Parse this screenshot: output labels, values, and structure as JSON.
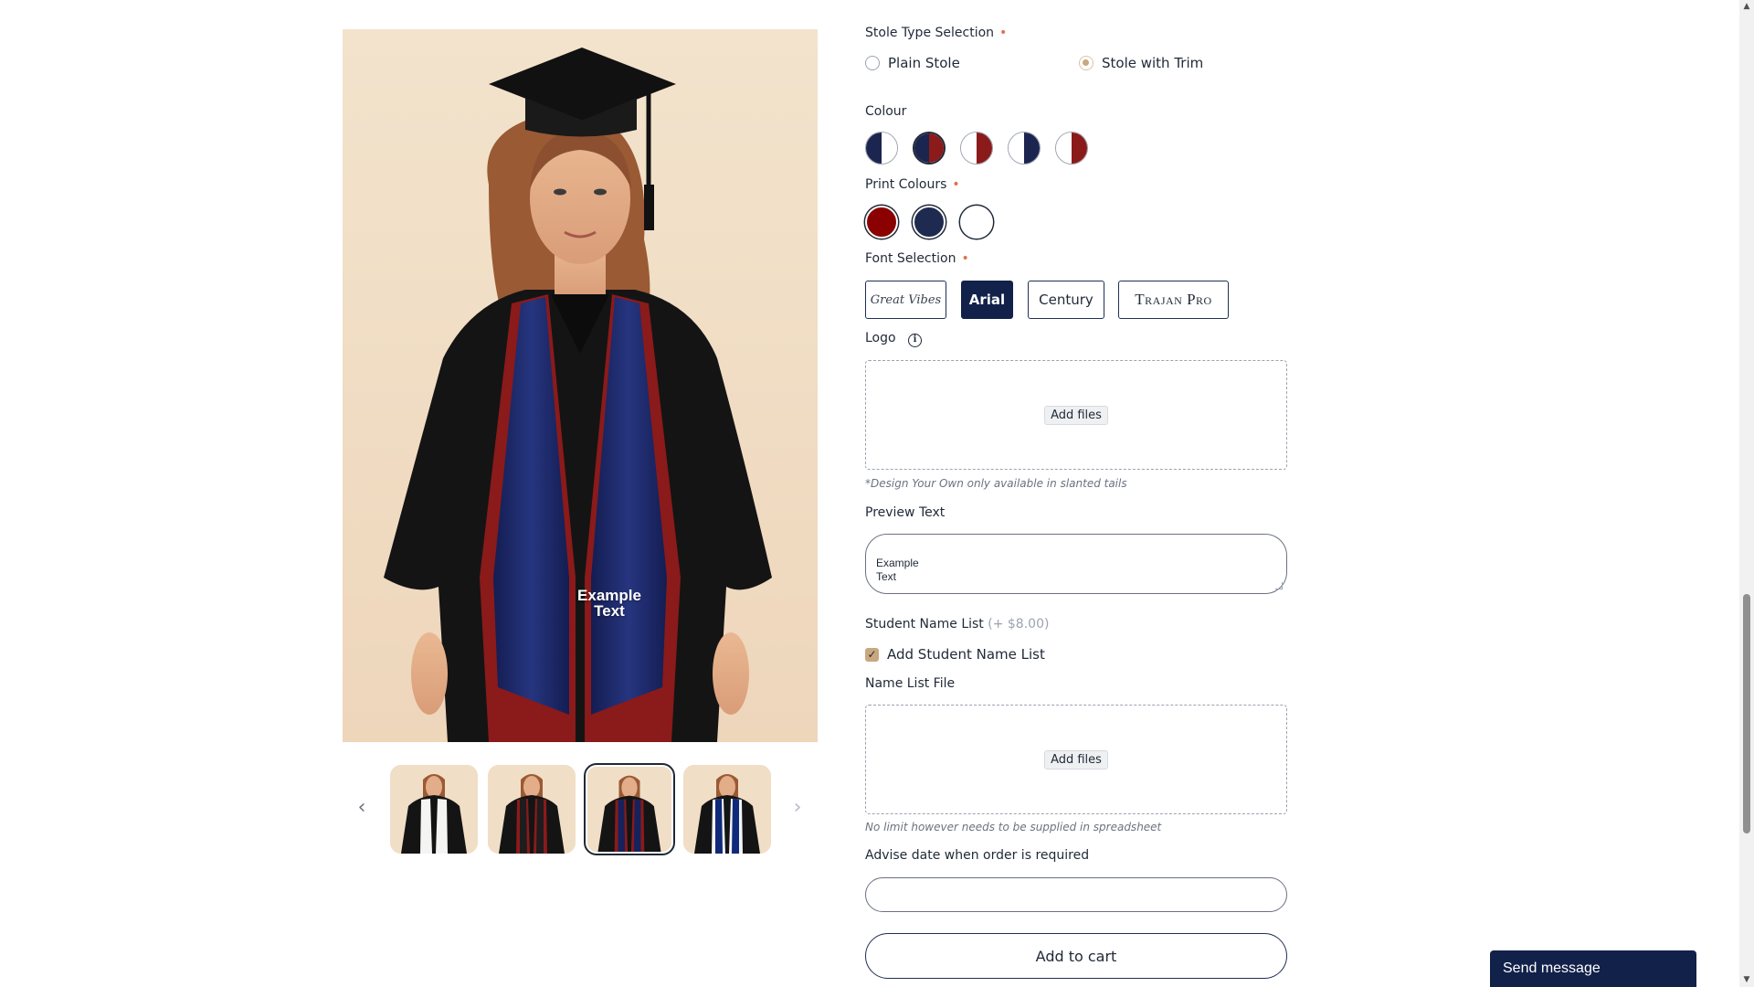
{
  "gallery": {
    "preview_text": "Example\nText",
    "prev_icon": "chevron-left-icon",
    "next_icon": "chevron-right-icon",
    "thumbnails": [
      {
        "stole": "#f4f4f2",
        "trim": "#ffffff"
      },
      {
        "stole": "#1d1d1f",
        "trim": "#8b1a1a"
      },
      {
        "stole": "#16225c",
        "trim": "#8b1a1a"
      },
      {
        "stole": "#102a7a",
        "trim": "#f4f4f4"
      }
    ],
    "active_thumbnail": 3
  },
  "stole_type": {
    "label": "Stole Type Selection",
    "required_mark": "•",
    "options": [
      "Plain Stole",
      "Stole with Trim"
    ],
    "selected": "Stole with Trim"
  },
  "colour": {
    "label": "Colour",
    "swatches": [
      {
        "left": "#1b2550",
        "right": "#ffffff"
      },
      {
        "left": "#1b2550",
        "right": "#8b1a1a"
      },
      {
        "left": "#ffffff",
        "right": "#8b1a1a"
      },
      {
        "left": "#ffffff",
        "right": "#1b2550"
      },
      {
        "left": "#ffffff",
        "right": "#8b1a1a"
      }
    ],
    "selected_index": 2
  },
  "print_colours": {
    "label": "Print Colours",
    "required_mark": "•",
    "dots": [
      "#8b0000",
      "#1e2a4f",
      "#ffffff"
    ]
  },
  "font_selection": {
    "label": "Font Selection",
    "required_mark": "•",
    "options": [
      "Great Vibes",
      "Arial",
      "Century",
      "Trajan Pro"
    ],
    "selected": "Arial"
  },
  "logo": {
    "label": "Logo",
    "info_icon": "info-icon",
    "info_glyph": "i",
    "button": "Add files",
    "note": "*Design Your Own only available in slanted tails"
  },
  "preview_text": {
    "label": "Preview Text",
    "value": "Example\nText"
  },
  "student_names": {
    "label": "Student Name List",
    "price": "(+ $8.00)",
    "checkbox_label": "Add Student Name List",
    "checked": true,
    "check_glyph": "✓"
  },
  "name_list_file": {
    "label": "Name List File",
    "button": "Add files",
    "note": "No limit however needs to be supplied in spreadsheet"
  },
  "date": {
    "label": "Advise date when order is required",
    "value": ""
  },
  "cart": {
    "label": "Add to cart"
  },
  "chat": {
    "label": "Send message"
  },
  "scrollbar": {
    "up": "▲",
    "down": "▼"
  },
  "colors": {
    "navy": "#12214a",
    "accent_tan": "#c9a77f",
    "required": "#e0714b"
  }
}
